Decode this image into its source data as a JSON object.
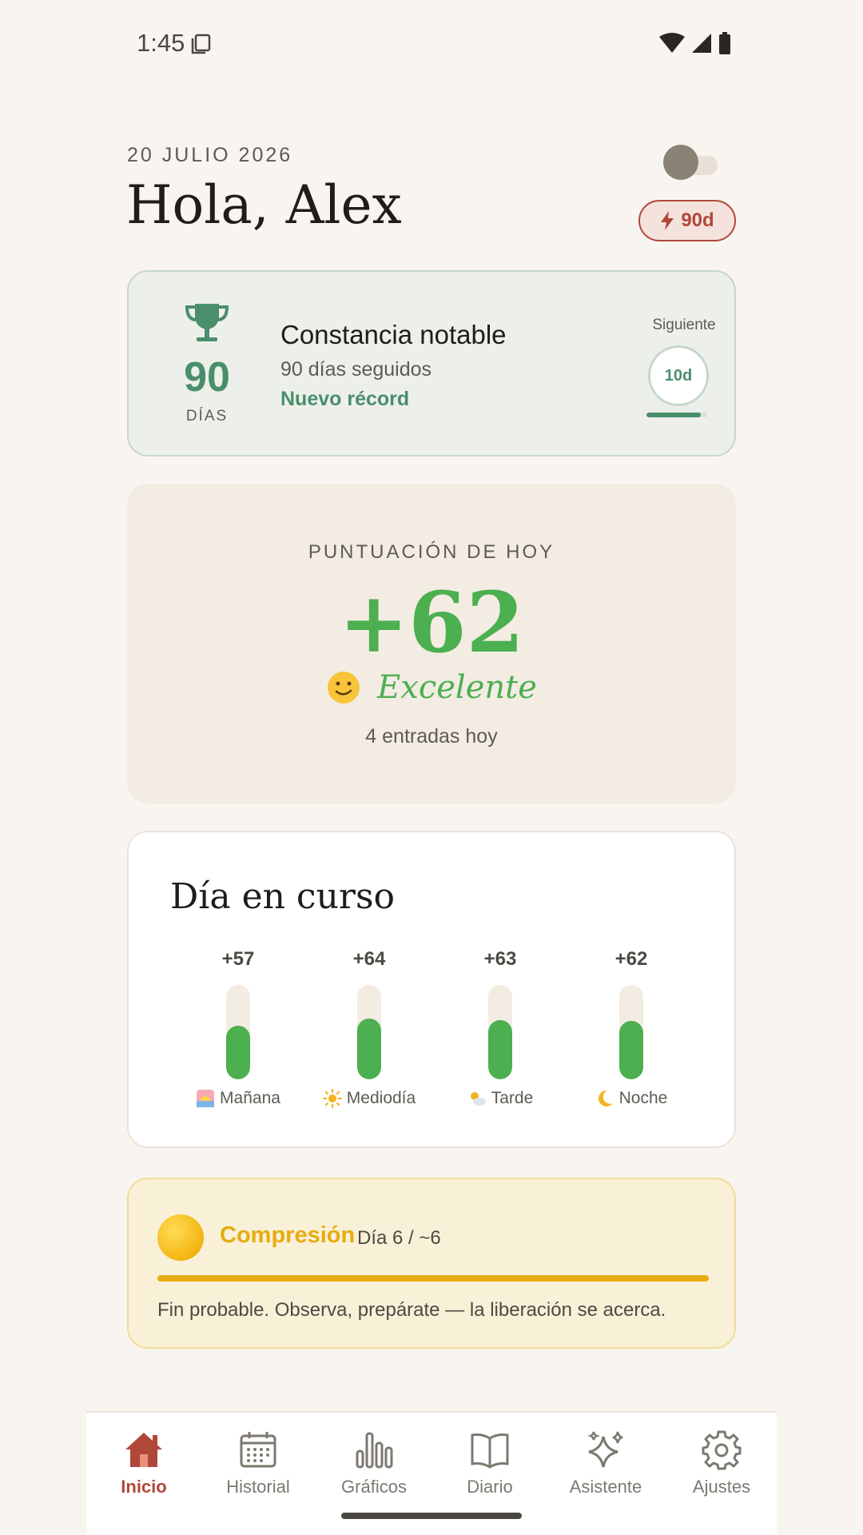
{
  "status_bar": {
    "time": "1:45"
  },
  "header": {
    "date": "20 JULIO 2026",
    "greeting": "Hola, Alex",
    "streak_badge": "90d",
    "dark_mode_toggle": false
  },
  "achievement": {
    "days": "90",
    "days_label": "DÍAS",
    "title": "Constancia notable",
    "subtitle": "90 días seguidos",
    "record": "Nuevo récord",
    "next_label": "Siguiente",
    "next_value": "10d",
    "next_progress": 0.9
  },
  "score": {
    "label": "PUNTUACIÓN DE HOY",
    "value": "+62",
    "mood": "Excelente",
    "entries": "4 entradas hoy"
  },
  "day": {
    "title": "Día en curso",
    "max": 100,
    "periods": [
      {
        "value": "+57",
        "label": "Mañana",
        "icon": "sunrise-icon",
        "level": 57
      },
      {
        "value": "+64",
        "label": "Mediodía",
        "icon": "sun-icon",
        "level": 64
      },
      {
        "value": "+63",
        "label": "Tarde",
        "icon": "sun-cloud-icon",
        "level": 63
      },
      {
        "value": "+62",
        "label": "Noche",
        "icon": "moon-icon",
        "level": 62
      }
    ]
  },
  "phase": {
    "title": "Compresión",
    "day": "Día 6 / ~6",
    "progress": 1.0,
    "description": "Fin probable. Observa, prepárate — la liberación se acerca."
  },
  "nav": {
    "items": [
      {
        "label": "Inicio",
        "icon": "home-icon",
        "active": true
      },
      {
        "label": "Historial",
        "icon": "calendar-icon",
        "active": false
      },
      {
        "label": "Gráficos",
        "icon": "bar-chart-icon",
        "active": false
      },
      {
        "label": "Diario",
        "icon": "book-icon",
        "active": false
      },
      {
        "label": "Asistente",
        "icon": "sparkles-icon",
        "active": false
      },
      {
        "label": "Ajustes",
        "icon": "gear-icon",
        "active": false
      }
    ]
  },
  "colors": {
    "accent_green": "#4caf50",
    "streak_red": "#b0483a",
    "phase_yellow": "#e6ac10",
    "achievement_green": "#4a8e6b"
  }
}
